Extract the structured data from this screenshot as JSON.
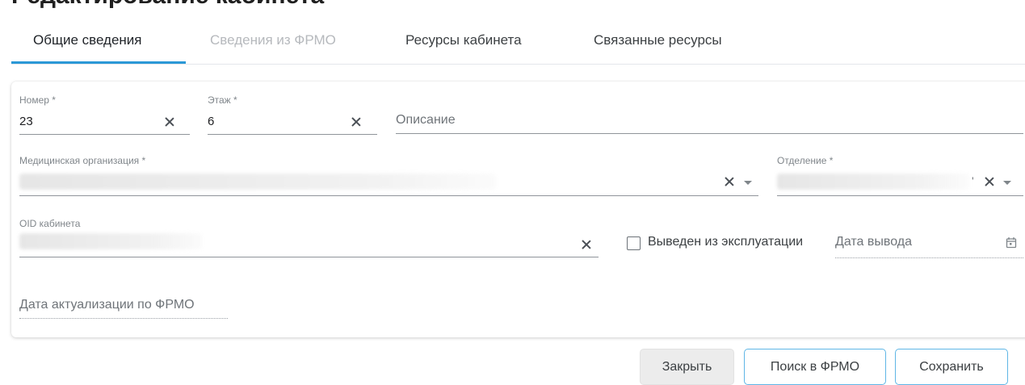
{
  "header": {
    "title": "Редактирование кабинета"
  },
  "tabs": [
    {
      "label": "Общие сведения",
      "state": "active"
    },
    {
      "label": "Сведения из ФРМО",
      "state": "disabled"
    },
    {
      "label": "Ресурсы кабинета",
      "state": "normal"
    },
    {
      "label": "Связанные ресурсы",
      "state": "normal"
    }
  ],
  "form": {
    "number": {
      "label": "Номер *",
      "value": "23"
    },
    "floor": {
      "label": "Этаж *",
      "value": "6"
    },
    "description": {
      "placeholder": "Описание"
    },
    "med_org": {
      "label": "Медицинская организация *",
      "value_hidden": true
    },
    "department": {
      "label": "Отделение *",
      "value_hidden": true,
      "value_tail": "'"
    },
    "oid": {
      "label": "OID кабинета",
      "value_hidden": true
    },
    "decommissioned": {
      "label": "Выведен из эксплуатации",
      "checked": false
    },
    "decommission_date": {
      "placeholder": "Дата вывода"
    },
    "frmo_update_date": {
      "placeholder": "Дата актуализации по ФРМО"
    }
  },
  "buttons": {
    "close": "Закрыть",
    "search_frmo": "Поиск в ФРМО",
    "save": "Сохранить"
  },
  "colors": {
    "accent": "#2b98d6",
    "button_outline": "#5fb6e6",
    "button_grey": "#ececec"
  }
}
